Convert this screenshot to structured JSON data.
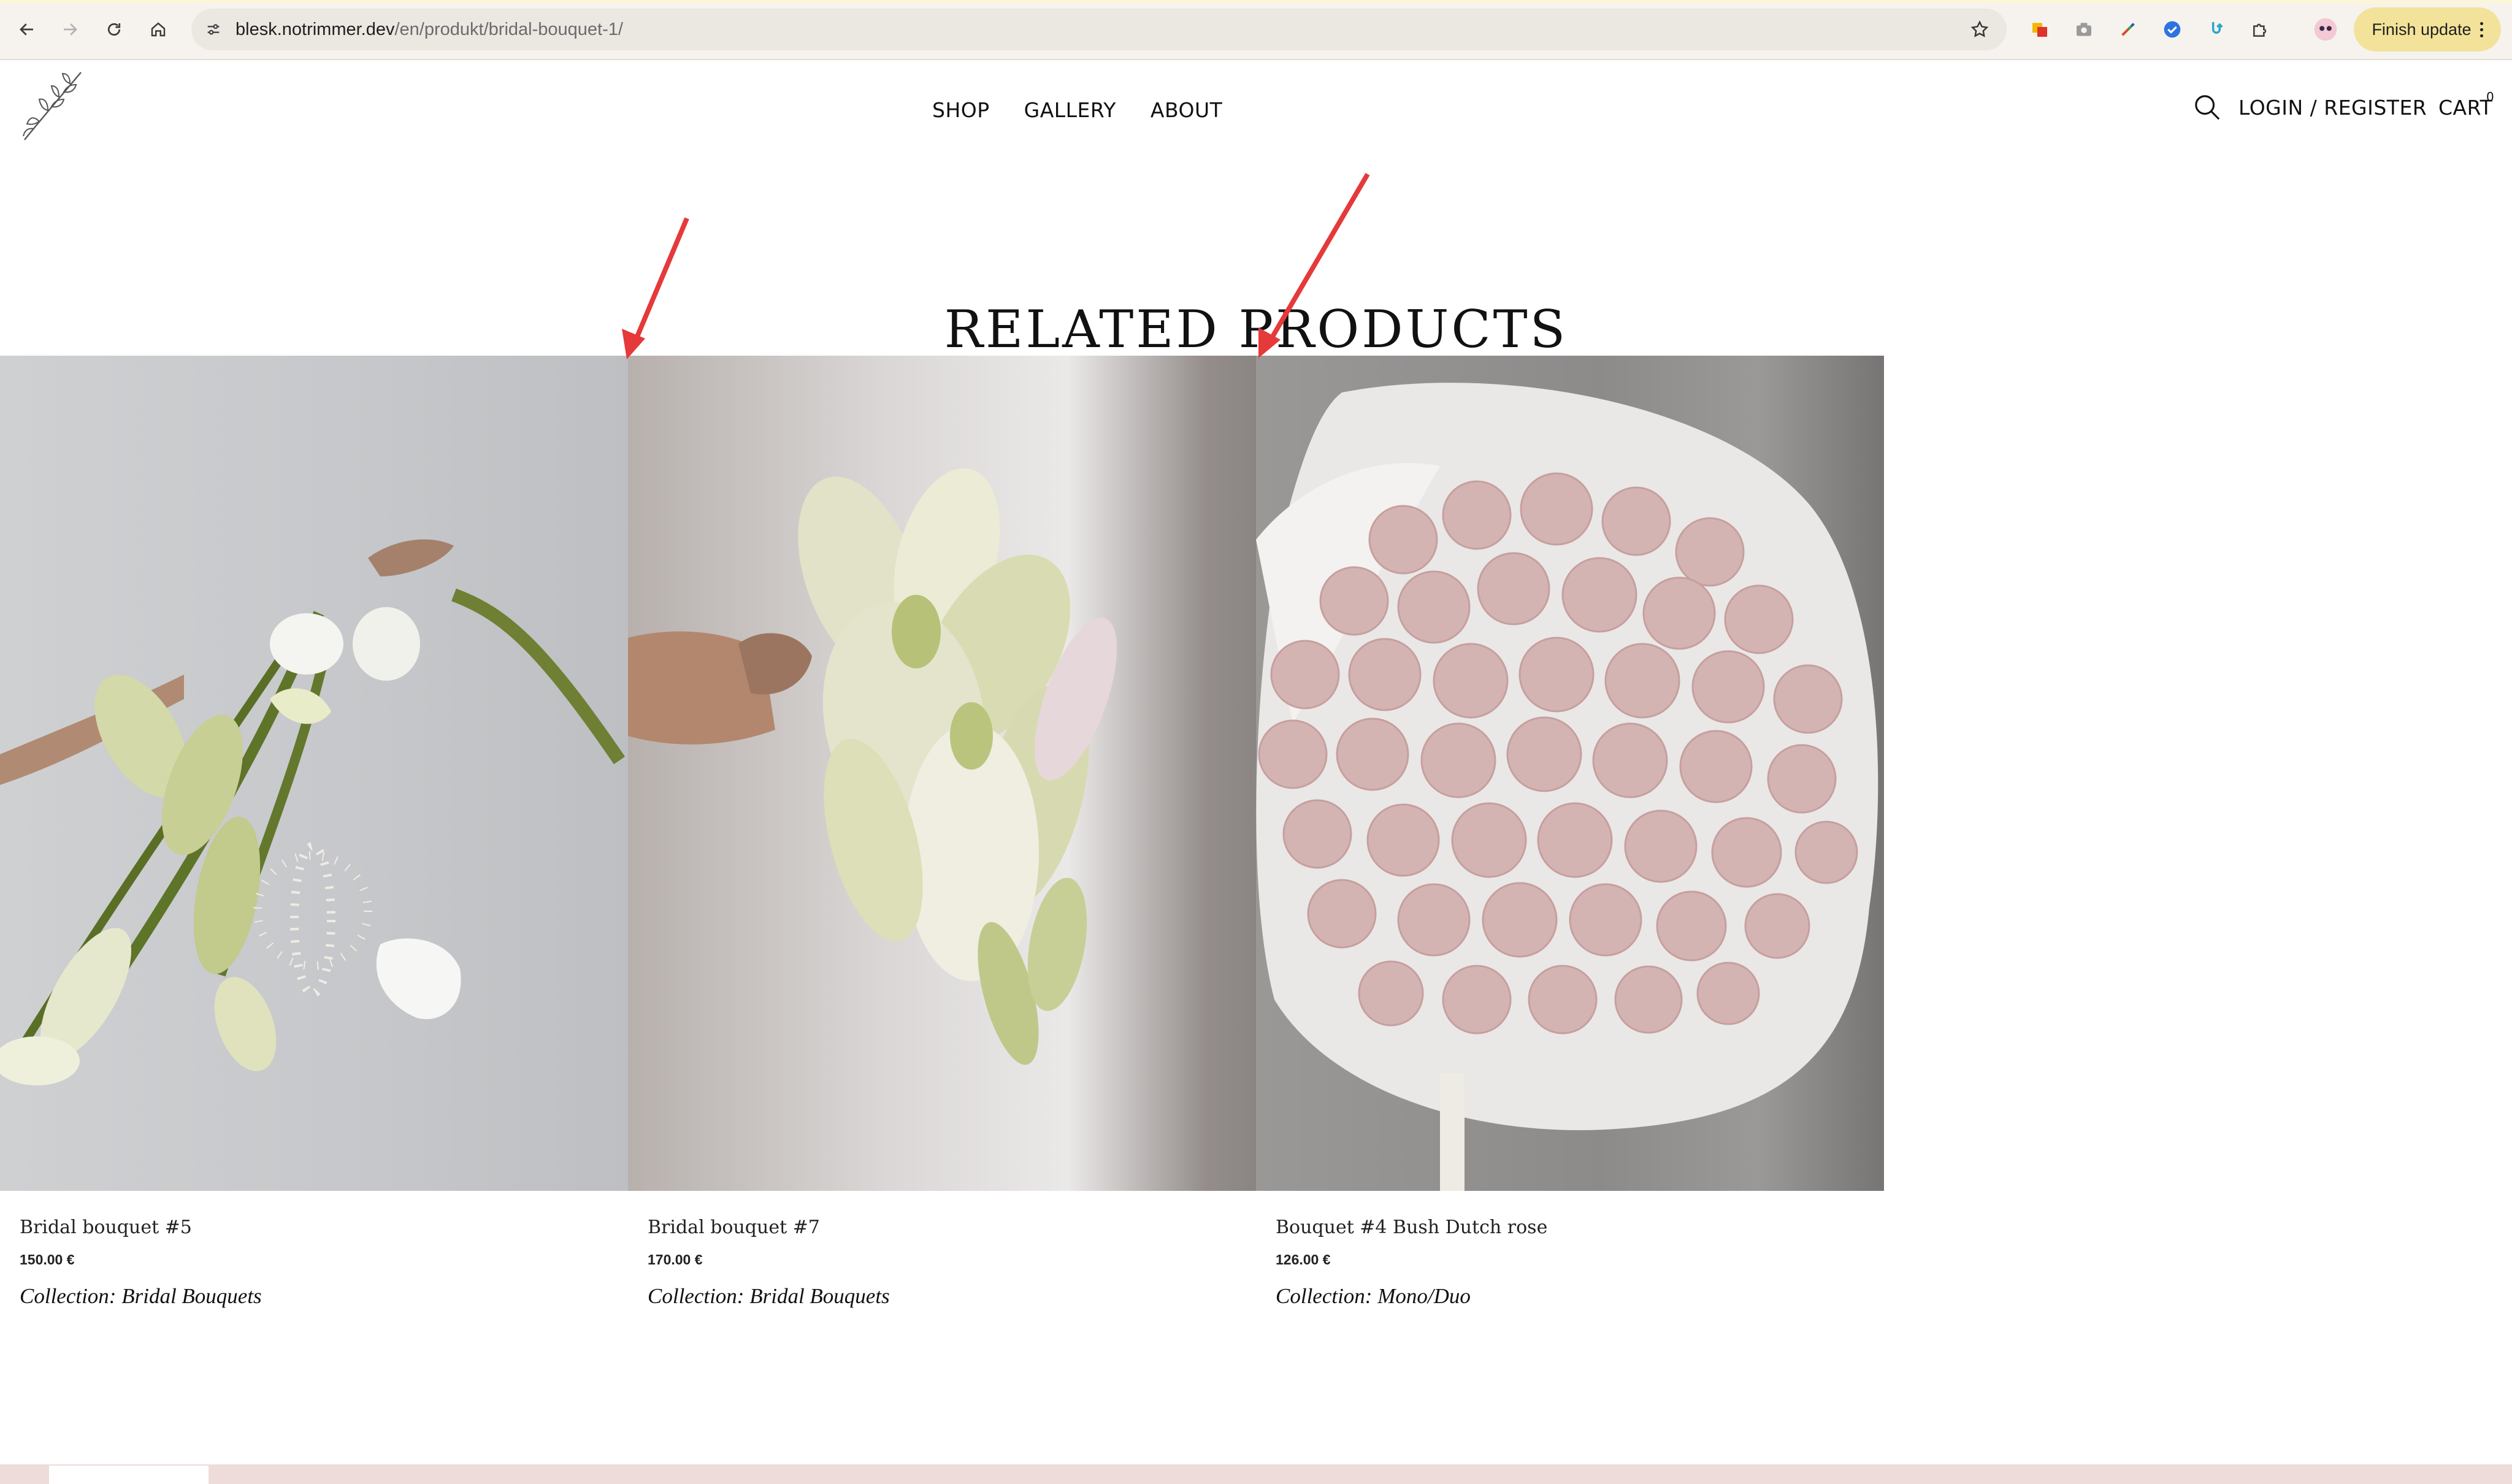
{
  "browser": {
    "url_host": "blesk.notrimmer.dev",
    "url_path": "/en/produkt/bridal-bouquet-1/",
    "finish_update_label": "Finish update"
  },
  "header": {
    "nav": [
      "SHOP",
      "GALLERY",
      "ABOUT"
    ],
    "login_label": "LOGIN / REGISTER",
    "cart_label": "CART",
    "cart_count": "0"
  },
  "section": {
    "title": "RELATED PRODUCTS"
  },
  "products": [
    {
      "name": "Bridal bouquet #5",
      "price": "150.00 €",
      "collection": "Collection: Bridal Bouquets"
    },
    {
      "name": "Bridal bouquet #7",
      "price": "170.00 €",
      "collection": "Collection: Bridal Bouquets"
    },
    {
      "name": "Bouquet #4 Bush Dutch rose",
      "price": "126.00 €",
      "collection": "Collection: Mono/Duo"
    }
  ],
  "colors": {
    "annotation_arrow": "#e5393a",
    "update_button": "#f3e39a",
    "footer_band": "#eddcd9"
  }
}
